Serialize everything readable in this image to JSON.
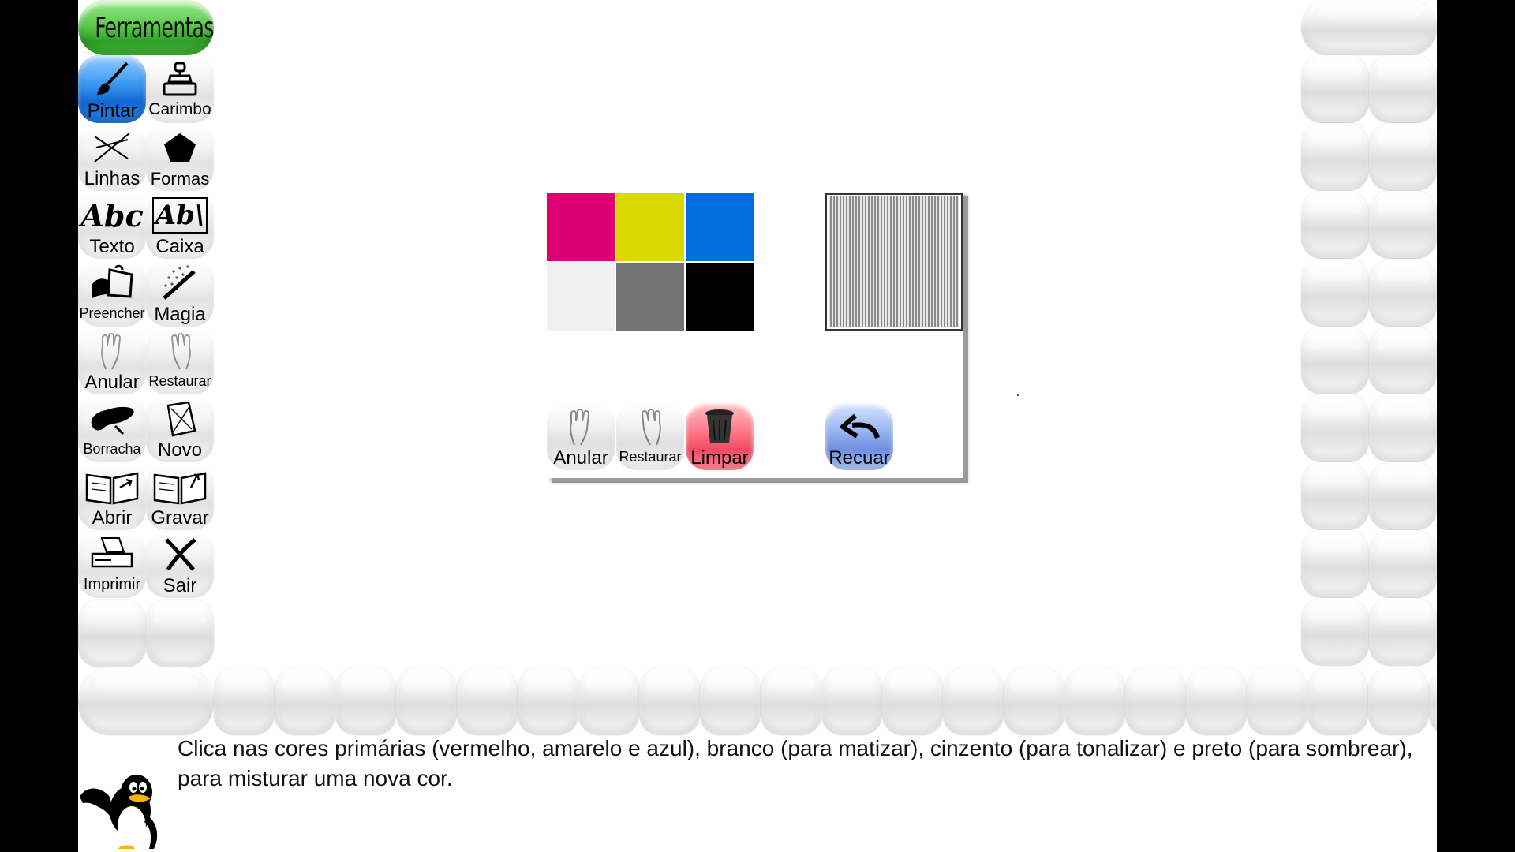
{
  "toolbar": {
    "title": "Ferramentas",
    "tools": [
      {
        "label": "Pintar",
        "icon": "paintbrush-icon"
      },
      {
        "label": "Carimbo",
        "icon": "stamp-icon"
      },
      {
        "label": "Linhas",
        "icon": "lines-icon"
      },
      {
        "label": "Formas",
        "icon": "pentagon-icon"
      },
      {
        "label": "Texto",
        "icon": "text-icon"
      },
      {
        "label": "Caixa",
        "icon": "textbox-icon"
      },
      {
        "label": "Preencher",
        "icon": "paint-bucket-icon"
      },
      {
        "label": "Magia",
        "icon": "magic-wand-icon"
      },
      {
        "label": "Anular",
        "icon": "undo-hand-icon"
      },
      {
        "label": "Restaurar",
        "icon": "redo-hand-icon"
      },
      {
        "label": "Borracha",
        "icon": "eraser-icon"
      },
      {
        "label": "Novo",
        "icon": "new-document-icon"
      },
      {
        "label": "Abrir",
        "icon": "open-book-icon"
      },
      {
        "label": "Gravar",
        "icon": "save-book-icon"
      },
      {
        "label": "Imprimir",
        "icon": "printer-icon"
      },
      {
        "label": "Sair",
        "icon": "exit-x-icon"
      }
    ]
  },
  "mixer": {
    "swatches": [
      {
        "name": "magenta",
        "color": "#DC0073"
      },
      {
        "name": "yellow",
        "color": "#D9D800"
      },
      {
        "name": "blue",
        "color": "#006FDB"
      },
      {
        "name": "white",
        "color": "#F0F0F0"
      },
      {
        "name": "grey",
        "color": "#737373"
      },
      {
        "name": "black",
        "color": "#000000"
      }
    ],
    "buttons": {
      "undo": "Anular",
      "redo": "Restaurar",
      "clear": "Limpar",
      "back": "Recuar"
    }
  },
  "status": {
    "message": "Clica nas cores primárias (vermelho, amarelo e azul), branco (para matizar), cinzento (para tonalizar) e preto (para sombrear), para misturar uma nova cor."
  }
}
